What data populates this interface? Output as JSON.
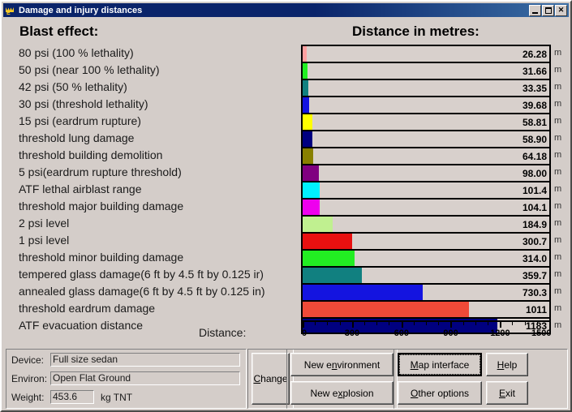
{
  "window": {
    "title": "Damage and injury distances",
    "icon": "explosion-app-icon",
    "minimize_label": "_",
    "maximize_label": "□",
    "close_label": "✕"
  },
  "headings": {
    "left": "Blast effect:",
    "right": "Distance in metres:"
  },
  "axis_caption": "Distance:",
  "unit": "m",
  "chart_data": {
    "type": "bar",
    "orientation": "horizontal",
    "title": "Distance in metres:",
    "xlabel": "Distance:",
    "ylabel": "Blast effect:",
    "xlim": [
      0,
      1500
    ],
    "grid": false,
    "legend": "none",
    "ticks_major": [
      0,
      300,
      600,
      900,
      1200,
      1500
    ],
    "tick_labels": [
      "0",
      "300",
      "600",
      "900",
      "1200",
      "1500"
    ],
    "minor_ticks_per_major": 3,
    "categories": [
      "80 psi (100 % lethality)",
      "50 psi (near 100 % lethality)",
      "42 psi (50 % lethality)",
      "30 psi (threshold lethality)",
      "15 psi (eardrum rupture)",
      "threshold lung damage",
      "threshold building demolition",
      "5 psi(eardrum rupture threshold)",
      "ATF lethal airblast range",
      "threshold major building damage",
      "2 psi level",
      "1 psi level",
      "threshold minor building damage",
      "tempered glass damage(6 ft by 4.5 ft by 0.125 ir)",
      "annealed glass damage(6 ft by 4.5 ft by 0.125 in)",
      "threshold eardrum damage",
      "ATF evacuation distance"
    ],
    "values": [
      26.28,
      31.66,
      33.35,
      39.68,
      58.81,
      58.9,
      64.18,
      98.0,
      101.4,
      104.1,
      184.9,
      300.7,
      314.0,
      359.7,
      730.3,
      1011,
      1183
    ],
    "value_labels": [
      "26.28",
      "31.66",
      "33.35",
      "39.68",
      "58.81",
      "58.90",
      "64.18",
      "98.00",
      "101.4",
      "104.1",
      "184.9",
      "300.7",
      "314.0",
      "359.7",
      "730.3",
      "1011",
      "1183"
    ],
    "colors": [
      "#ffa0a0",
      "#22ee22",
      "#118080",
      "#1414e0",
      "#ffff00",
      "#000080",
      "#888000",
      "#800080",
      "#00f0ff",
      "#ee00ee",
      "#c0f090",
      "#e81010",
      "#22ee22",
      "#118080",
      "#1414e0",
      "#ef4a38",
      "#000080"
    ]
  },
  "params": {
    "device_label": "Device:",
    "device_value": "Full size sedan",
    "environ_label": "Environ:",
    "environ_value": "Open Flat Ground",
    "weight_label": "Weight:",
    "weight_value": "453.6",
    "weight_unit": "kg TNT"
  },
  "buttons": {
    "change": {
      "pre": "",
      "ak": "C",
      "post": "hange"
    },
    "new_environment": {
      "pre": "New e",
      "ak": "n",
      "post": "vironment"
    },
    "new_explosion": {
      "pre": "New e",
      "ak": "x",
      "post": "plosion"
    },
    "map_interface": {
      "pre": "",
      "ak": "M",
      "post": "ap interface"
    },
    "help": {
      "pre": "",
      "ak": "H",
      "post": "elp"
    },
    "other_options": {
      "pre": "",
      "ak": "O",
      "post": "ther options"
    },
    "exit": {
      "pre": "",
      "ak": "E",
      "post": "xit"
    }
  }
}
